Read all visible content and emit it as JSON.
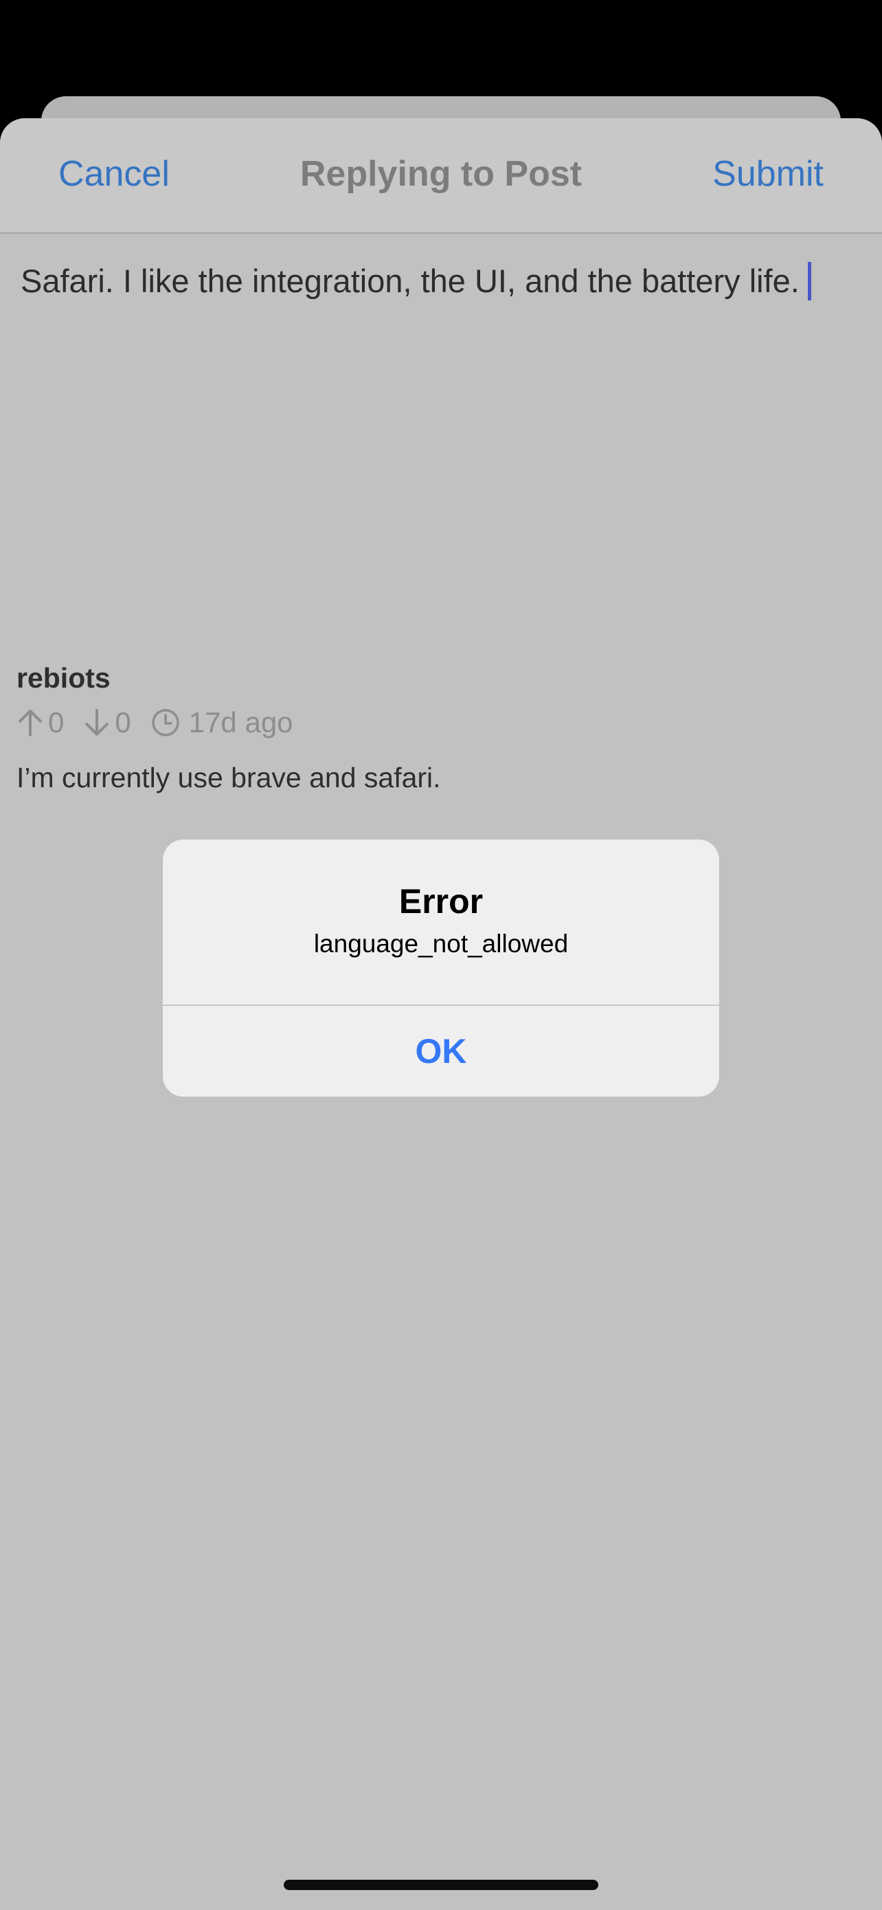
{
  "nav": {
    "cancel_label": "Cancel",
    "title": "Replying to Post",
    "submit_label": "Submit"
  },
  "editor": {
    "text": "Safari. I like the integration, the UI, and the battery life."
  },
  "comment": {
    "author": "rebiots",
    "upvotes": "0",
    "downvotes": "0",
    "age": "17d ago",
    "body": "I’m currently use brave and safari."
  },
  "alert": {
    "title": "Error",
    "message": "language_not_allowed",
    "ok_label": "OK"
  },
  "colors": {
    "accent": "#3674c2",
    "alert_button": "#3478f6",
    "caret": "#4a55c8",
    "overlay_background": "#c1c1c1"
  },
  "icons": {
    "upvote": "arrow-up-icon",
    "downvote": "arrow-down-icon",
    "time": "clock-icon"
  }
}
